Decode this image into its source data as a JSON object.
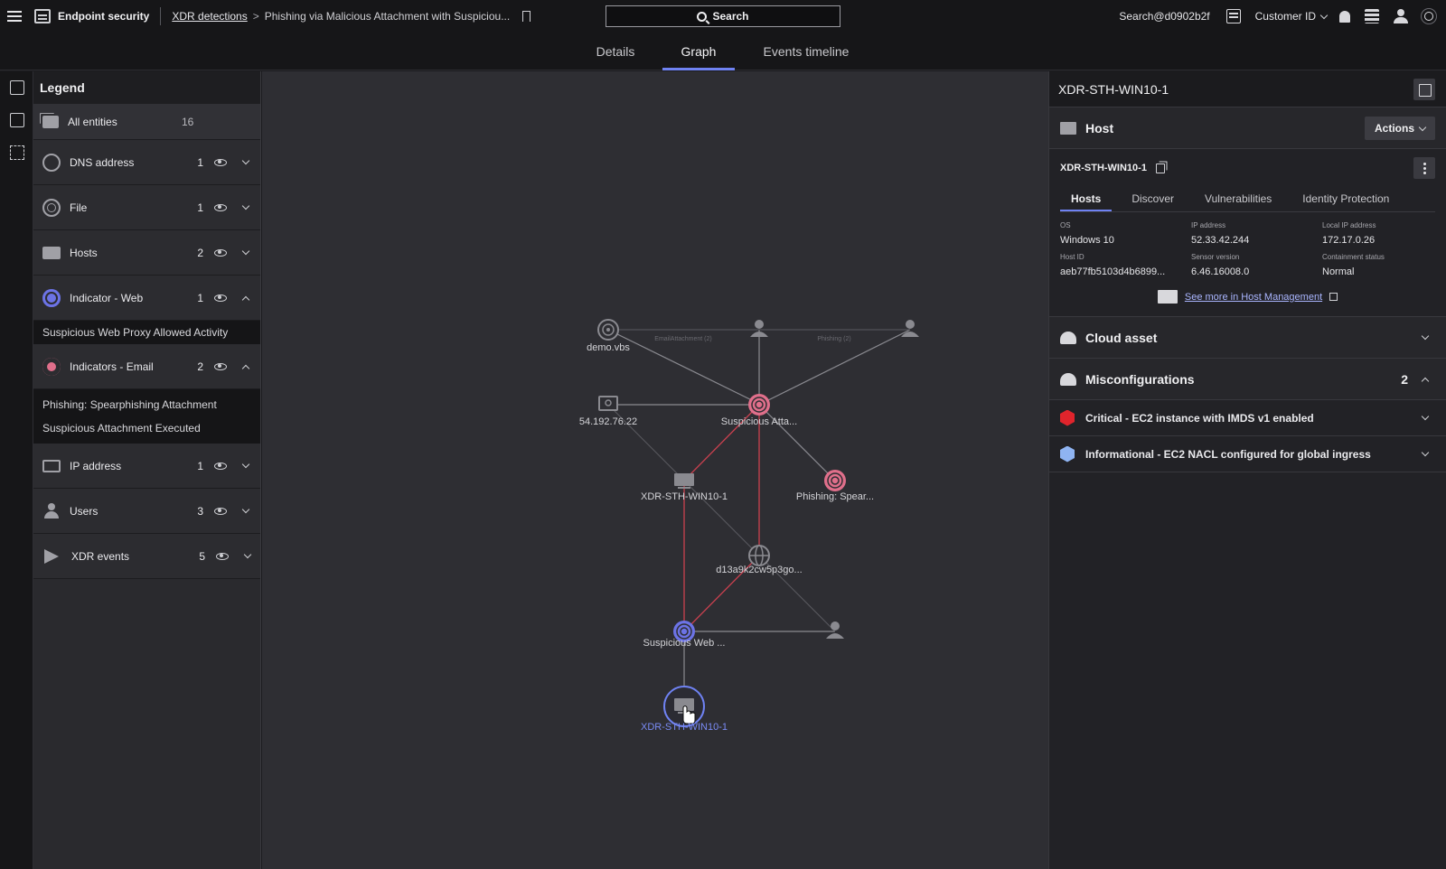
{
  "header": {
    "app_name": "Endpoint security",
    "breadcrumb_link": "XDR detections",
    "breadcrumb_separator": ">",
    "breadcrumb_current": "Phishing via Malicious Attachment with Suspiciou...",
    "search_label": "Search",
    "user_email": "Search@d0902b2f",
    "customer_label": "Customer ID"
  },
  "tabs": [
    {
      "label": "Details",
      "active": false
    },
    {
      "label": "Graph",
      "active": true
    },
    {
      "label": "Events timeline",
      "active": false
    }
  ],
  "legend": {
    "title": "Legend",
    "all_entities": {
      "label": "All entities",
      "count": "16"
    },
    "items": [
      {
        "label": "DNS address",
        "count": "1",
        "icon": "globe-icon",
        "expanded": false,
        "subitems": []
      },
      {
        "label": "File",
        "count": "1",
        "icon": "fingerprint-icon",
        "expanded": false,
        "subitems": []
      },
      {
        "label": "Hosts",
        "count": "2",
        "icon": "host-icon",
        "expanded": false,
        "subitems": []
      },
      {
        "label": "Indicator - Web",
        "count": "1",
        "icon": "indicator-web-icon",
        "expanded": true,
        "subitems": [
          "Suspicious Web Proxy Allowed Activity"
        ]
      },
      {
        "label": "Indicators - Email",
        "count": "2",
        "icon": "indicator-email-icon",
        "expanded": true,
        "subitems": [
          "Phishing: Spearphishing Attachment",
          "Suspicious Attachment Executed"
        ]
      },
      {
        "label": "IP address",
        "count": "1",
        "icon": "ip-icon",
        "expanded": false,
        "subitems": []
      },
      {
        "label": "Users",
        "count": "3",
        "icon": "users-icon",
        "expanded": false,
        "subitems": []
      },
      {
        "label": "XDR events",
        "count": "5",
        "icon": "xdr-events-icon",
        "expanded": false,
        "subitems": []
      }
    ]
  },
  "graph": {
    "node_labels": {
      "demo": "demo.vbs",
      "ip": "54.192.76.22",
      "susp_att": "Suspicious Atta...",
      "host_mid": "XDR-STH-WIN10-1",
      "phish": "Phishing: Spear...",
      "dns": "d13a9k2cw5p3go...",
      "susp_web": "Suspicious Web ...",
      "host_sel": "XDR-STH-WIN10-1"
    },
    "edge_labels": {
      "email_attachment": "EmailAttachment (2)",
      "phishing": "Phishing (2)"
    }
  },
  "panel": {
    "title": "XDR-STH-WIN10-1",
    "host_section": {
      "title": "Host",
      "actions_label": "Actions",
      "host_name": "XDR-STH-WIN10-1",
      "subtabs": [
        {
          "label": "Hosts",
          "active": true
        },
        {
          "label": "Discover",
          "active": false
        },
        {
          "label": "Vulnerabilities",
          "active": false
        },
        {
          "label": "Identity Protection",
          "active": false
        }
      ],
      "fields": {
        "os": {
          "k": "OS",
          "v": "Windows 10"
        },
        "ip": {
          "k": "IP address",
          "v": "52.33.42.244"
        },
        "local_ip": {
          "k": "Local IP address",
          "v": "172.17.0.26"
        },
        "host_id": {
          "k": "Host ID",
          "v": "aeb77fb5103d4b6899..."
        },
        "sensor": {
          "k": "Sensor version",
          "v": "6.46.16008.0"
        },
        "containment": {
          "k": "Containment status",
          "v": "Normal"
        }
      },
      "see_more": "See more in Host Management"
    },
    "cloud_asset": {
      "title": "Cloud asset"
    },
    "misconfigurations": {
      "title": "Misconfigurations",
      "count": "2",
      "items": [
        {
          "label": "Critical - EC2 instance with IMDS v1 enabled",
          "severity": "critical",
          "color": "#e0242c"
        },
        {
          "label": "Informational - EC2 NACL configured for global ingress",
          "severity": "informational",
          "color": "#8fb4f2"
        }
      ]
    }
  },
  "colors": {
    "accent": "#6f82f2",
    "indicator_web": "#6c73e6",
    "indicator_email": "#e06f8b",
    "edge_red": "#c9414f"
  }
}
